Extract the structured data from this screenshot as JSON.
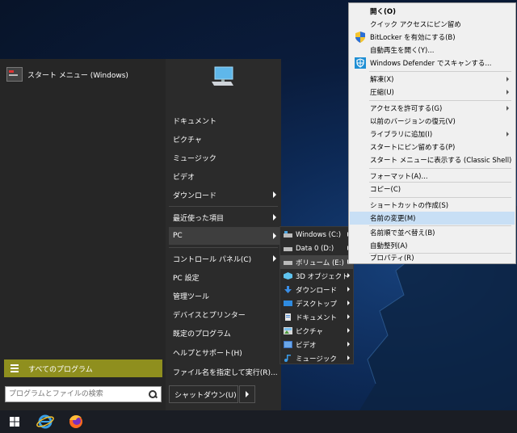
{
  "start_menu": {
    "pinned_label": "スタート メニュー (Windows)",
    "all_programs_label": "すべてのプログラム",
    "search_placeholder": "プログラムとファイルの検索",
    "shutdown_label": "シャットダウン(U)",
    "right_items": [
      "ドキュメント",
      "ピクチャ",
      "ミュージック",
      "ビデオ",
      "ダウンロード",
      "最近使った項目",
      "PC",
      "コントロール パネル(C)",
      "PC 設定",
      "管理ツール",
      "デバイスとプリンター",
      "既定のプログラム",
      "ヘルプとサポート(H)",
      "ファイル名を指定して実行(R)..."
    ]
  },
  "pc_submenu": {
    "items": [
      {
        "label": "Windows (C:)",
        "icon": "drive-windows-icon"
      },
      {
        "label": "Data 0 (D:)",
        "icon": "drive-icon"
      },
      {
        "label": "ボリューム (E:)",
        "icon": "drive-icon"
      },
      {
        "label": "3D オブジェクト",
        "icon": "3d-objects-icon"
      },
      {
        "label": "ダウンロード",
        "icon": "download-icon"
      },
      {
        "label": "デスクトップ",
        "icon": "desktop-icon"
      },
      {
        "label": "ドキュメント",
        "icon": "document-icon"
      },
      {
        "label": "ピクチャ",
        "icon": "pictures-icon"
      },
      {
        "label": "ビデオ",
        "icon": "video-icon"
      },
      {
        "label": "ミュージック",
        "icon": "music-icon"
      }
    ]
  },
  "context_menu": {
    "items": [
      "開く(O)",
      "クイック アクセスにピン留め",
      "BitLocker を有効にする(B)",
      "自動再生を開く(Y)...",
      "Windows Defender でスキャンする...",
      "解凍(X)",
      "圧縮(U)",
      "アクセスを許可する(G)",
      "以前のバージョンの復元(V)",
      "ライブラリに追加(I)",
      "スタートにピン留めする(P)",
      "スタート メニューに表示する (Classic Shell)",
      "フォーマット(A)...",
      "コピー(C)",
      "ショートカットの作成(S)",
      "名前の変更(M)",
      "名前順で並べ替え(B)",
      "自動整列(A)",
      "プロパティ(R)"
    ]
  },
  "taskbar": {
    "items": [
      "windows-start-icon",
      "internet-explorer-icon",
      "firefox-icon"
    ]
  },
  "colors": {
    "all_programs_bg": "#8f8f1e",
    "context_highlight": "#c8dff5"
  }
}
